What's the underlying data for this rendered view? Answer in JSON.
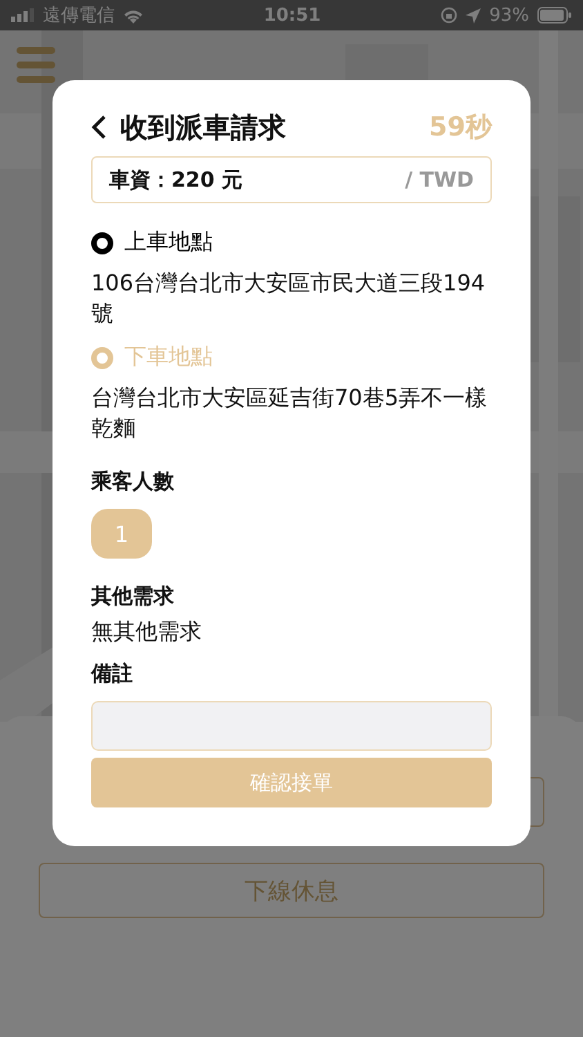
{
  "status_bar": {
    "carrier": "遠傳電信",
    "time": "10:51",
    "battery": "93%"
  },
  "bottom_sheet": {
    "location_field": {
      "kind": "field"
    },
    "offline_button": "下線休息"
  },
  "dialog": {
    "title": "收到派車請求",
    "countdown": "59秒",
    "fare": {
      "label": "車資：",
      "amount": "220 元",
      "currency": "/ TWD"
    },
    "points": [
      {
        "label": "上車地點",
        "color": "#000000",
        "address": "106台灣台北市大安區市民大道三段194號"
      },
      {
        "label": "下車地點",
        "color": "#e3c596",
        "address": "台灣台北市大安區延吉街70巷5弄不一樣乾麵"
      }
    ],
    "passengers": {
      "label": "乘客人數",
      "count": "1"
    },
    "requests": {
      "label": "其他需求",
      "value": "無其他需求"
    },
    "note": {
      "label": "備註"
    },
    "confirm_button": "確認接單"
  }
}
